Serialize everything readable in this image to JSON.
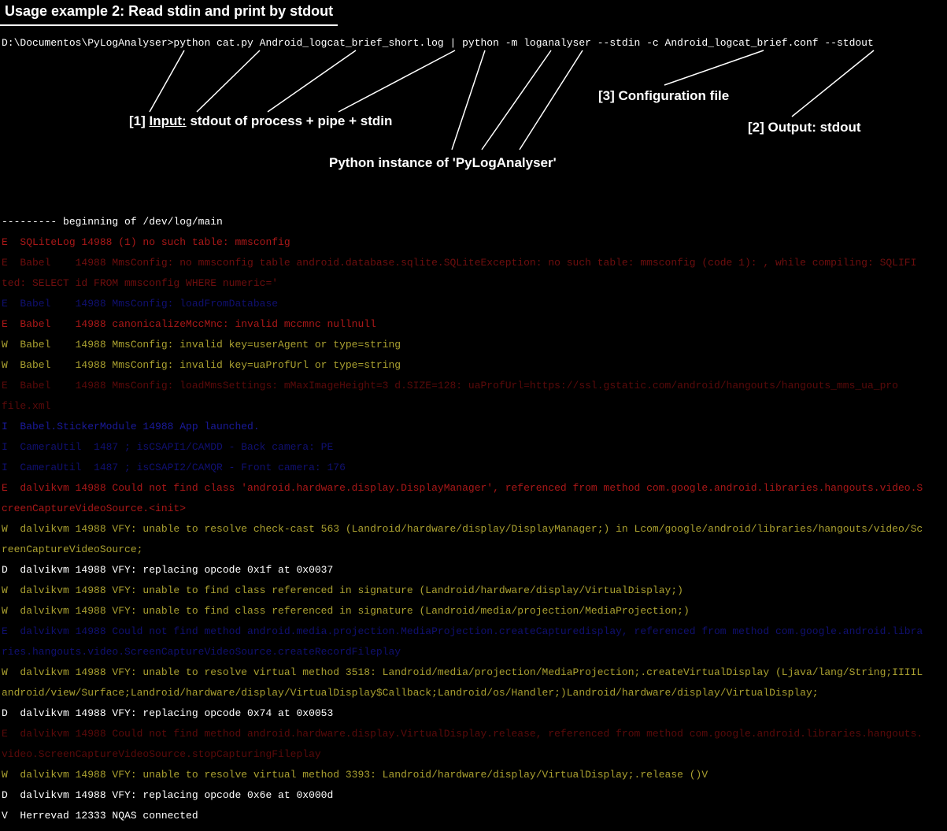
{
  "title": "Usage example 2: Read stdin and print by stdout",
  "command": "D:\\Documentos\\PyLogAnalyser>python cat.py Android_logcat_brief_short.log | python -m loganalyser --stdin -c Android_logcat_brief.conf --stdout",
  "annotations": {
    "input": {
      "num": "[1]",
      "key": "Input:",
      "text": " stdout of process + pipe + stdin"
    },
    "output": {
      "num": "[2]",
      "key": "Output: stdout"
    },
    "config": {
      "num": "[3]",
      "text": "Configuration file"
    },
    "instance": "Python instance of 'PyLogAnalyser'"
  },
  "log": {
    "begin": "--------- beginning of /dev/log/main",
    "l1": "E  SQLiteLog 14988 (1) no such table: mmsconfig",
    "l2": "E  Babel    14988 MmsConfig: no mmsconfig table android.database.sqlite.SQLiteException: no such table: mmsconfig (code 1): , while compiling: SQLIFI",
    "l3": "ted: SELECT id FROM mmsconfig WHERE numeric='",
    "l4": "E  Babel    14988 MmsConfig: loadFromDatabase",
    "l5": "E  Babel    14988 canonicalizeMccMnc: invalid mccmnc nullnull",
    "l6": "W  Babel    14988 MmsConfig: invalid key=userAgent or type=string",
    "l7": "W  Babel    14988 MmsConfig: invalid key=uaProfUrl or type=string",
    "l8": "E  Babel    14988 MmsConfig: loadMmsSettings: mMaxImageHeight=3 d.SIZE=128: uaProfUrl=https://ssl.gstatic.com/android/hangouts/hangouts_mms_ua_pro",
    "l9": "file.xml",
    "l10": "I  Babel.StickerModule 14988 App launched.",
    "l11": "I  CameraUtil  1487 ; isCSAPI1/CAMDD - Back camera: PE",
    "l12": "I  CameraUtil  1487 ; isCSAPI2/CAMQR - Front camera: 176",
    "l13": "E  dalvikvm 14988 Could not find class 'android.hardware.display.DisplayManager', referenced from method com.google.android.libraries.hangouts.video.S",
    "l14": "creenCaptureVideoSource.<init>",
    "l15": "W  dalvikvm 14988 VFY: unable to resolve check-cast 563 (Landroid/hardware/display/DisplayManager;) in Lcom/google/android/libraries/hangouts/video/Sc",
    "l16": "reenCaptureVideoSource;",
    "l17": "D  dalvikvm 14988 VFY: replacing opcode 0x1f at 0x0037",
    "l18": "W  dalvikvm 14988 VFY: unable to find class referenced in signature (Landroid/hardware/display/VirtualDisplay;)",
    "l19": "W  dalvikvm 14988 VFY: unable to find class referenced in signature (Landroid/media/projection/MediaProjection;)",
    "l20": "E  dalvikvm 14988 Could not find method android.media.projection.MediaProjection.createCapturedisplay, referenced from method com.google.android.libra",
    "l21": "ries.hangouts.video.ScreenCaptureVideoSource.createRecordFileplay",
    "l22": "W  dalvikvm 14988 VFY: unable to resolve virtual method 3518: Landroid/media/projection/MediaProjection;.createVirtualDisplay (Ljava/lang/String;IIIIL",
    "l23": "android/view/Surface;Landroid/hardware/display/VirtualDisplay$Callback;Landroid/os/Handler;)Landroid/hardware/display/VirtualDisplay;",
    "l24": "D  dalvikvm 14988 VFY: replacing opcode 0x74 at 0x0053",
    "l25": "E  dalvikvm 14988 Could not find method android.hardware.display.VirtualDisplay.release, referenced from method com.google.android.libraries.hangouts.",
    "l26": "video.ScreenCaptureVideoSource.stopCapturingFileplay",
    "l27": "W  dalvikvm 14988 VFY: unable to resolve virtual method 3393: Landroid/hardware/display/VirtualDisplay;.release ()V",
    "l28": "D  dalvikvm 14988 VFY: replacing opcode 0x6e at 0x000d",
    "l29": "V  Herrevad 12333 NQAS connected"
  }
}
